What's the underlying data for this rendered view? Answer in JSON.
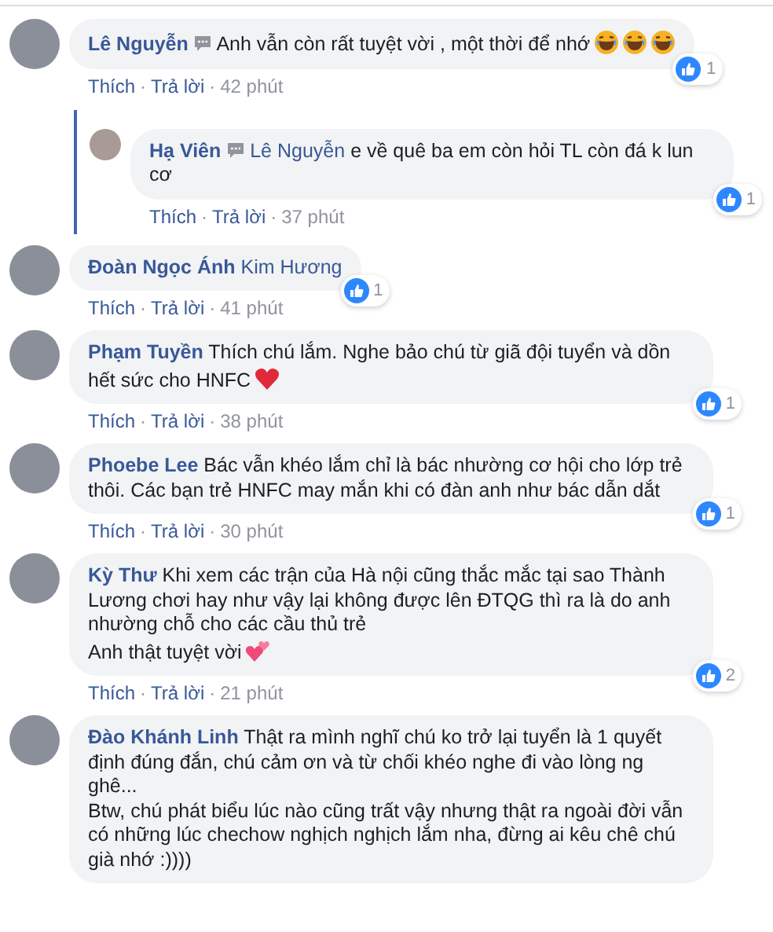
{
  "separator": "·",
  "comments": [
    {
      "author": "Lê Nguyễn",
      "messenger_badge": true,
      "text": "Anh vẫn còn rất tuyệt vời , một thời để nhớ",
      "emoji": [
        {
          "kind": "laugh"
        },
        {
          "kind": "laugh"
        },
        {
          "kind": "laugh"
        }
      ],
      "actions": [
        "Thích",
        "Trả lời"
      ],
      "time": "42 phút",
      "likes": "1",
      "replies": [
        {
          "author": "Hạ Viên",
          "messenger_badge": true,
          "mention": "Lê Nguyễn",
          "text": "e về quê ba em còn hỏi TL còn đá k lun cơ",
          "actions": [
            "Thích",
            "Trả lời"
          ],
          "time": "37 phút",
          "likes": "1"
        }
      ]
    },
    {
      "author": "Đoàn Ngọc Ánh",
      "messenger_badge": false,
      "mention": "Kim Hương",
      "actions": [
        "Thích",
        "Trả lời"
      ],
      "time": "41 phút",
      "likes": "1"
    },
    {
      "author": "Phạm Tuyền",
      "messenger_badge": false,
      "text": "Thích chú lắm. Nghe bảo chú từ giã đội tuyển và dồn hết sức cho HNFC",
      "emoji": [
        {
          "kind": "heart"
        }
      ],
      "actions": [
        "Thích",
        "Trả lời"
      ],
      "time": "38 phút",
      "likes": "1"
    },
    {
      "author": "Phoebe Lee",
      "messenger_badge": false,
      "text": "Bác vẫn khéo lắm chỉ là bác nhường cơ hội cho lớp trẻ thôi. Các bạn trẻ HNFC may mắn khi có đàn anh như bác dẫn dắt",
      "actions": [
        "Thích",
        "Trả lời"
      ],
      "time": "30 phút",
      "likes": "1"
    },
    {
      "author": "Kỳ Thư",
      "messenger_badge": false,
      "text": "Khi xem các trận của Hà nội cũng thắc mắc tại sao Thành Lương chơi hay như vậy lại không được lên ĐTQG thì ra là do anh nhường chỗ cho các cầu thủ trẻ\nAnh thật tuyệt vời",
      "emoji": [
        {
          "kind": "two-hearts"
        }
      ],
      "actions": [
        "Thích",
        "Trả lời"
      ],
      "time": "21 phút",
      "likes": "2"
    },
    {
      "author": "Đào Khánh Linh",
      "messenger_badge": false,
      "text": "Thật ra mình nghĩ chú ko trở lại tuyển là 1 quyết định đúng đắn, chú cảm ơn và từ chối khéo nghe đi vào lòng ng ghê...\nBtw, chú phát biểu lúc nào cũng trất vậy nhưng thật ra ngoài đời vẫn có những lúc chechow nghịch nghịch lắm nha, đừng ai kêu chê chú già nhớ :))))"
    }
  ]
}
